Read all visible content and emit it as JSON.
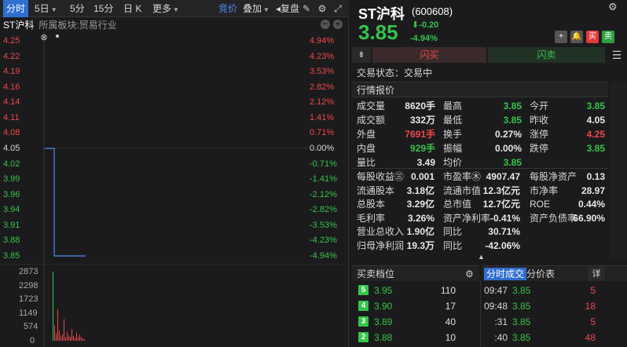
{
  "toolbar": {
    "tabs": [
      {
        "label": "分时",
        "active": true
      },
      {
        "label": "5日",
        "dropdown": true
      },
      {
        "label": "5分"
      },
      {
        "label": "15分"
      },
      {
        "label": "日 K"
      },
      {
        "label": "更多",
        "dropdown": true
      }
    ],
    "auction_label": "竞价",
    "overlay_label": "叠加",
    "replay_label": "复盘",
    "icons": [
      "pencil-icon",
      "gear-icon",
      "expand-icon"
    ]
  },
  "chart_header": {
    "stock_short": "ST沪科",
    "board_text": "所属板块:贸易行业"
  },
  "chart_data": {
    "type": "line",
    "price_axis": [
      "4.25",
      "4.22",
      "4.19",
      "4.16",
      "4.14",
      "4.11",
      "4.08",
      "4.05",
      "4.02",
      "3.99",
      "3.96",
      "3.94",
      "3.91",
      "3.88",
      "3.85"
    ],
    "pct_axis": [
      "4.94%",
      "4.23%",
      "3.53%",
      "2.82%",
      "2.12%",
      "1.41%",
      "0.71%",
      "0.00%",
      "-0.71%",
      "-1.41%",
      "-2.12%",
      "-2.82%",
      "-3.53%",
      "-4.23%",
      "-4.94%"
    ],
    "prev_close": 4.05,
    "ylim": [
      3.85,
      4.25
    ],
    "price_series": [
      4.05,
      4.05,
      4.05,
      3.85,
      3.85,
      3.85,
      3.85,
      3.85,
      3.85,
      3.85,
      3.85,
      3.85,
      3.85,
      3.85
    ],
    "volume_axis": [
      "2873",
      "2298",
      "1723",
      "1149",
      "574",
      "0"
    ],
    "volume_ylim": [
      0,
      2873
    ],
    "volumes": [
      2873,
      620,
      300,
      1300,
      420,
      180,
      260,
      900,
      140,
      380,
      220,
      160,
      480,
      200,
      110,
      320,
      140,
      260,
      150,
      90,
      60
    ],
    "volume_colors": [
      "grn",
      "red",
      "red",
      "red",
      "red",
      "red",
      "red",
      "red",
      "red",
      "red",
      "red",
      "red",
      "red",
      "red",
      "red",
      "red",
      "red",
      "red",
      "red",
      "red",
      "red"
    ]
  },
  "quote": {
    "name": "ST沪科",
    "code": "(600608)",
    "price": "3.85",
    "change": "-0.20",
    "change_pct": "-4.94%",
    "buttons": [
      "+",
      "🔔",
      "买",
      "卖"
    ],
    "buy_label": "闪买",
    "sell_label": "闪卖",
    "status_text": "交易状态：交易中",
    "section_title": "行情报价",
    "rows_a": [
      [
        "成交量",
        "8620手",
        "",
        "最高",
        "3.85",
        "grn",
        "今开",
        "3.85",
        "grn"
      ],
      [
        "成交额",
        "332万",
        "",
        "最低",
        "3.85",
        "grn",
        "昨收",
        "4.05",
        ""
      ],
      [
        "外盘",
        "7691手",
        "red",
        "换手",
        "0.27%",
        "",
        "涨停",
        "4.25",
        "red"
      ],
      [
        "内盘",
        "929手",
        "grn",
        "振幅",
        "0.00%",
        "",
        "跌停",
        "3.85",
        "grn"
      ],
      [
        "量比",
        "3.49",
        "",
        "均价",
        "3.85",
        "grn",
        "",
        "",
        ""
      ]
    ],
    "rows_b": [
      [
        "每股收益㊂",
        "0.001",
        "市盈率㊍",
        "4907.47",
        "每股净资产",
        "0.13"
      ],
      [
        "流通股本",
        "3.18亿",
        "流通市值",
        "12.3亿元",
        "市净率",
        "28.97"
      ],
      [
        "总股本",
        "3.29亿",
        "总市值",
        "12.7亿元",
        "ROE",
        "0.44%"
      ],
      [
        "毛利率",
        "3.26%",
        "资产净利率",
        "-0.41%",
        "资产负债率",
        "66.90%"
      ],
      [
        "营业总收入",
        "1.90亿",
        "同比",
        "30.71%",
        "",
        ""
      ],
      [
        "归母净利润",
        "19.3万",
        "同比",
        "-42.06%",
        "",
        ""
      ]
    ],
    "orderbook_title": "买卖档位",
    "orderbook": [
      {
        "level": "5",
        "price": "3.95",
        "vol": "110"
      },
      {
        "level": "4",
        "price": "3.90",
        "vol": "17"
      },
      {
        "level": "3",
        "price": "3.89",
        "vol": "40"
      },
      {
        "level": "2",
        "price": "3.88",
        "vol": "10"
      }
    ],
    "ticks_tab": "分时成交",
    "price_table_tab": "分价表",
    "detail_label": "详",
    "ticks": [
      {
        "time": "09:47",
        "price": "3.85",
        "vol": "5"
      },
      {
        "time": "09:48",
        "price": "3.85",
        "vol": "18"
      },
      {
        "time": ":31",
        "price": "3.85",
        "vol": "5"
      },
      {
        "time": ":40",
        "price": "3.85",
        "vol": "48"
      }
    ]
  }
}
